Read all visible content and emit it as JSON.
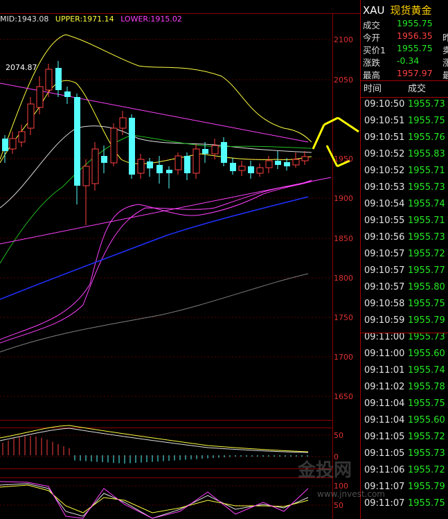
{
  "legend": {
    "mid": "MID:1943.08",
    "upper": "UPPER:1971.14",
    "lower": "LOWER:1915.02",
    "colors": {
      "mid": "#e0e0e0",
      "upper": "#ffff40",
      "lower": "#ff40ff"
    }
  },
  "peak_label": "2074.87",
  "price_axis": [
    "2100",
    "2050",
    "1950",
    "1900",
    "1850",
    "1800",
    "1750",
    "1700",
    "1650"
  ],
  "macd_axis": [
    "50",
    "0"
  ],
  "kdj_axis": [
    "100",
    "50"
  ],
  "quote": {
    "symbol": "XAU",
    "name": "现货黄金",
    "rows": [
      {
        "label": "成交",
        "value": "1955.75",
        "color": "#24e824",
        "extra": ""
      },
      {
        "label": "今开",
        "value": "1956.35",
        "color": "#ff4040",
        "extra": "昨"
      },
      {
        "label": "买价1",
        "value": "1955.75",
        "color": "#24e824",
        "extra": "卖"
      },
      {
        "label": "涨跌",
        "value": "-0.34",
        "color": "#24e824",
        "extra": "涨"
      },
      {
        "label": "最高",
        "value": "1957.97",
        "color": "#ff4040",
        "extra": "最"
      }
    ]
  },
  "trades_header": {
    "time": "时间",
    "price": "成交"
  },
  "trades": [
    {
      "time": "09:10:50",
      "price": "1955.73"
    },
    {
      "time": "09:10:51",
      "price": "1955.75"
    },
    {
      "time": "09:10:51",
      "price": "1955.76"
    },
    {
      "time": "09:10:52",
      "price": "1955.83"
    },
    {
      "time": "09:10:52",
      "price": "1955.71"
    },
    {
      "time": "09:10:53",
      "price": "1955.73"
    },
    {
      "time": "09:10:54",
      "price": "1955.74"
    },
    {
      "time": "09:10:55",
      "price": "1955.71"
    },
    {
      "time": "09:10:56",
      "price": "1955.73"
    },
    {
      "time": "09:10:57",
      "price": "1955.72"
    },
    {
      "time": "09:10:57",
      "price": "1955.77"
    },
    {
      "time": "09:10:57",
      "price": "1955.80"
    },
    {
      "time": "09:10:58",
      "price": "1955.75"
    },
    {
      "time": "09:10:59",
      "price": "1955.79"
    },
    {
      "time": "09:11:00",
      "price": "1955.73"
    },
    {
      "time": "09:11:00",
      "price": "1955.60"
    },
    {
      "time": "09:11:01",
      "price": "1955.74"
    },
    {
      "time": "09:11:02",
      "price": "1955.78"
    },
    {
      "time": "09:11:04",
      "price": "1955.75"
    },
    {
      "time": "09:11:04",
      "price": "1955.60"
    },
    {
      "time": "09:11:05",
      "price": "1955.72"
    },
    {
      "time": "09:11:05",
      "price": "1955.73"
    },
    {
      "time": "09:11:06",
      "price": "1955.72"
    },
    {
      "time": "09:11:07",
      "price": "1955.79"
    },
    {
      "time": "09:11:07",
      "price": "1955.75"
    }
  ],
  "watermark": "金投网",
  "watermark_url": "www.jnvest.com"
}
